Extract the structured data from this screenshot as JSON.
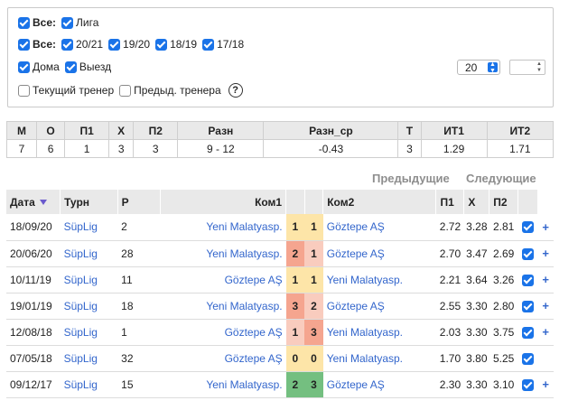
{
  "filters": {
    "row1": [
      {
        "label": "Все:",
        "checked": true,
        "bold": true
      },
      {
        "label": "Лига",
        "checked": true,
        "bold": false
      }
    ],
    "row2": [
      {
        "label": "Все:",
        "checked": true,
        "bold": true
      },
      {
        "label": "20/21",
        "checked": true,
        "bold": false
      },
      {
        "label": "19/20",
        "checked": true,
        "bold": false
      },
      {
        "label": "18/19",
        "checked": true,
        "bold": false
      },
      {
        "label": "17/18",
        "checked": true,
        "bold": false
      }
    ],
    "row3": [
      {
        "label": "Дома",
        "checked": true,
        "bold": false
      },
      {
        "label": "Выезд",
        "checked": true,
        "bold": false
      }
    ],
    "row4": [
      {
        "label": "Текущий тренер",
        "checked": false,
        "bold": false
      },
      {
        "label": "Предыд. тренера",
        "checked": false,
        "bold": false
      }
    ],
    "help_label": "?",
    "count_select": "20",
    "spin_value": ""
  },
  "stats": {
    "headers": [
      "М",
      "О",
      "П1",
      "Х",
      "П2",
      "Разн",
      "Разн_ср",
      "Т",
      "ИТ1",
      "ИТ2"
    ],
    "values": [
      "7",
      "6",
      "1",
      "3",
      "3",
      "9 - 12",
      "-0.43",
      "3",
      "1.29",
      "1.71"
    ]
  },
  "nav": {
    "prev": "Предыдущие",
    "next": "Следующие"
  },
  "matches": {
    "headers": {
      "date": "Дата",
      "tournament": "Турн",
      "round": "Р",
      "team1": "Ком1",
      "team2": "Ком2",
      "p1": "П1",
      "x": "Х",
      "p2": "П2"
    },
    "rows": [
      {
        "date": "18/09/20",
        "tournament": "SüpLig",
        "round": "2",
        "team1": "Yeni Malatyasp.",
        "g1": "1",
        "g2": "1",
        "team2": "Göztepe AŞ",
        "p1": "2.72",
        "x": "3.28",
        "p2": "2.81",
        "checked": true,
        "plus": "+"
      },
      {
        "date": "20/06/20",
        "tournament": "SüpLig",
        "round": "28",
        "team1": "Yeni Malatyasp.",
        "g1": "2",
        "g2": "1",
        "team2": "Göztepe AŞ",
        "p1": "2.70",
        "x": "3.47",
        "p2": "2.69",
        "checked": true,
        "plus": "+"
      },
      {
        "date": "10/11/19",
        "tournament": "SüpLig",
        "round": "11",
        "team1": "Göztepe AŞ",
        "g1": "1",
        "g2": "1",
        "team2": "Yeni Malatyasp.",
        "p1": "2.21",
        "x": "3.64",
        "p2": "3.26",
        "checked": true,
        "plus": "+"
      },
      {
        "date": "19/01/19",
        "tournament": "SüpLig",
        "round": "18",
        "team1": "Yeni Malatyasp.",
        "g1": "3",
        "g2": "2",
        "team2": "Göztepe AŞ",
        "p1": "2.55",
        "x": "3.30",
        "p2": "2.80",
        "checked": true,
        "plus": "+"
      },
      {
        "date": "12/08/18",
        "tournament": "SüpLig",
        "round": "1",
        "team1": "Göztepe AŞ",
        "g1": "1",
        "g2": "3",
        "team2": "Yeni Malatyasp.",
        "p1": "2.03",
        "x": "3.30",
        "p2": "3.75",
        "checked": true,
        "plus": "+"
      },
      {
        "date": "07/05/18",
        "tournament": "SüpLig",
        "round": "32",
        "team1": "Göztepe AŞ",
        "g1": "0",
        "g2": "0",
        "team2": "Yeni Malatyasp.",
        "p1": "1.70",
        "x": "3.80",
        "p2": "5.25",
        "checked": true,
        "plus": ""
      },
      {
        "date": "09/12/17",
        "tournament": "SüpLig",
        "round": "15",
        "team1": "Yeni Malatyasp.",
        "g1": "2",
        "g2": "3",
        "team2": "Göztepe AŞ",
        "p1": "2.30",
        "x": "3.30",
        "p2": "3.10",
        "checked": true,
        "plus": "+"
      }
    ]
  },
  "colors": {
    "accent": "#1a73e8",
    "link": "#3366cc",
    "draw": "#fde5a8",
    "win": "#f5a58f",
    "loss": "#f9ccbe",
    "green": "#74bf80",
    "header_bg": "#e9e9e9"
  }
}
